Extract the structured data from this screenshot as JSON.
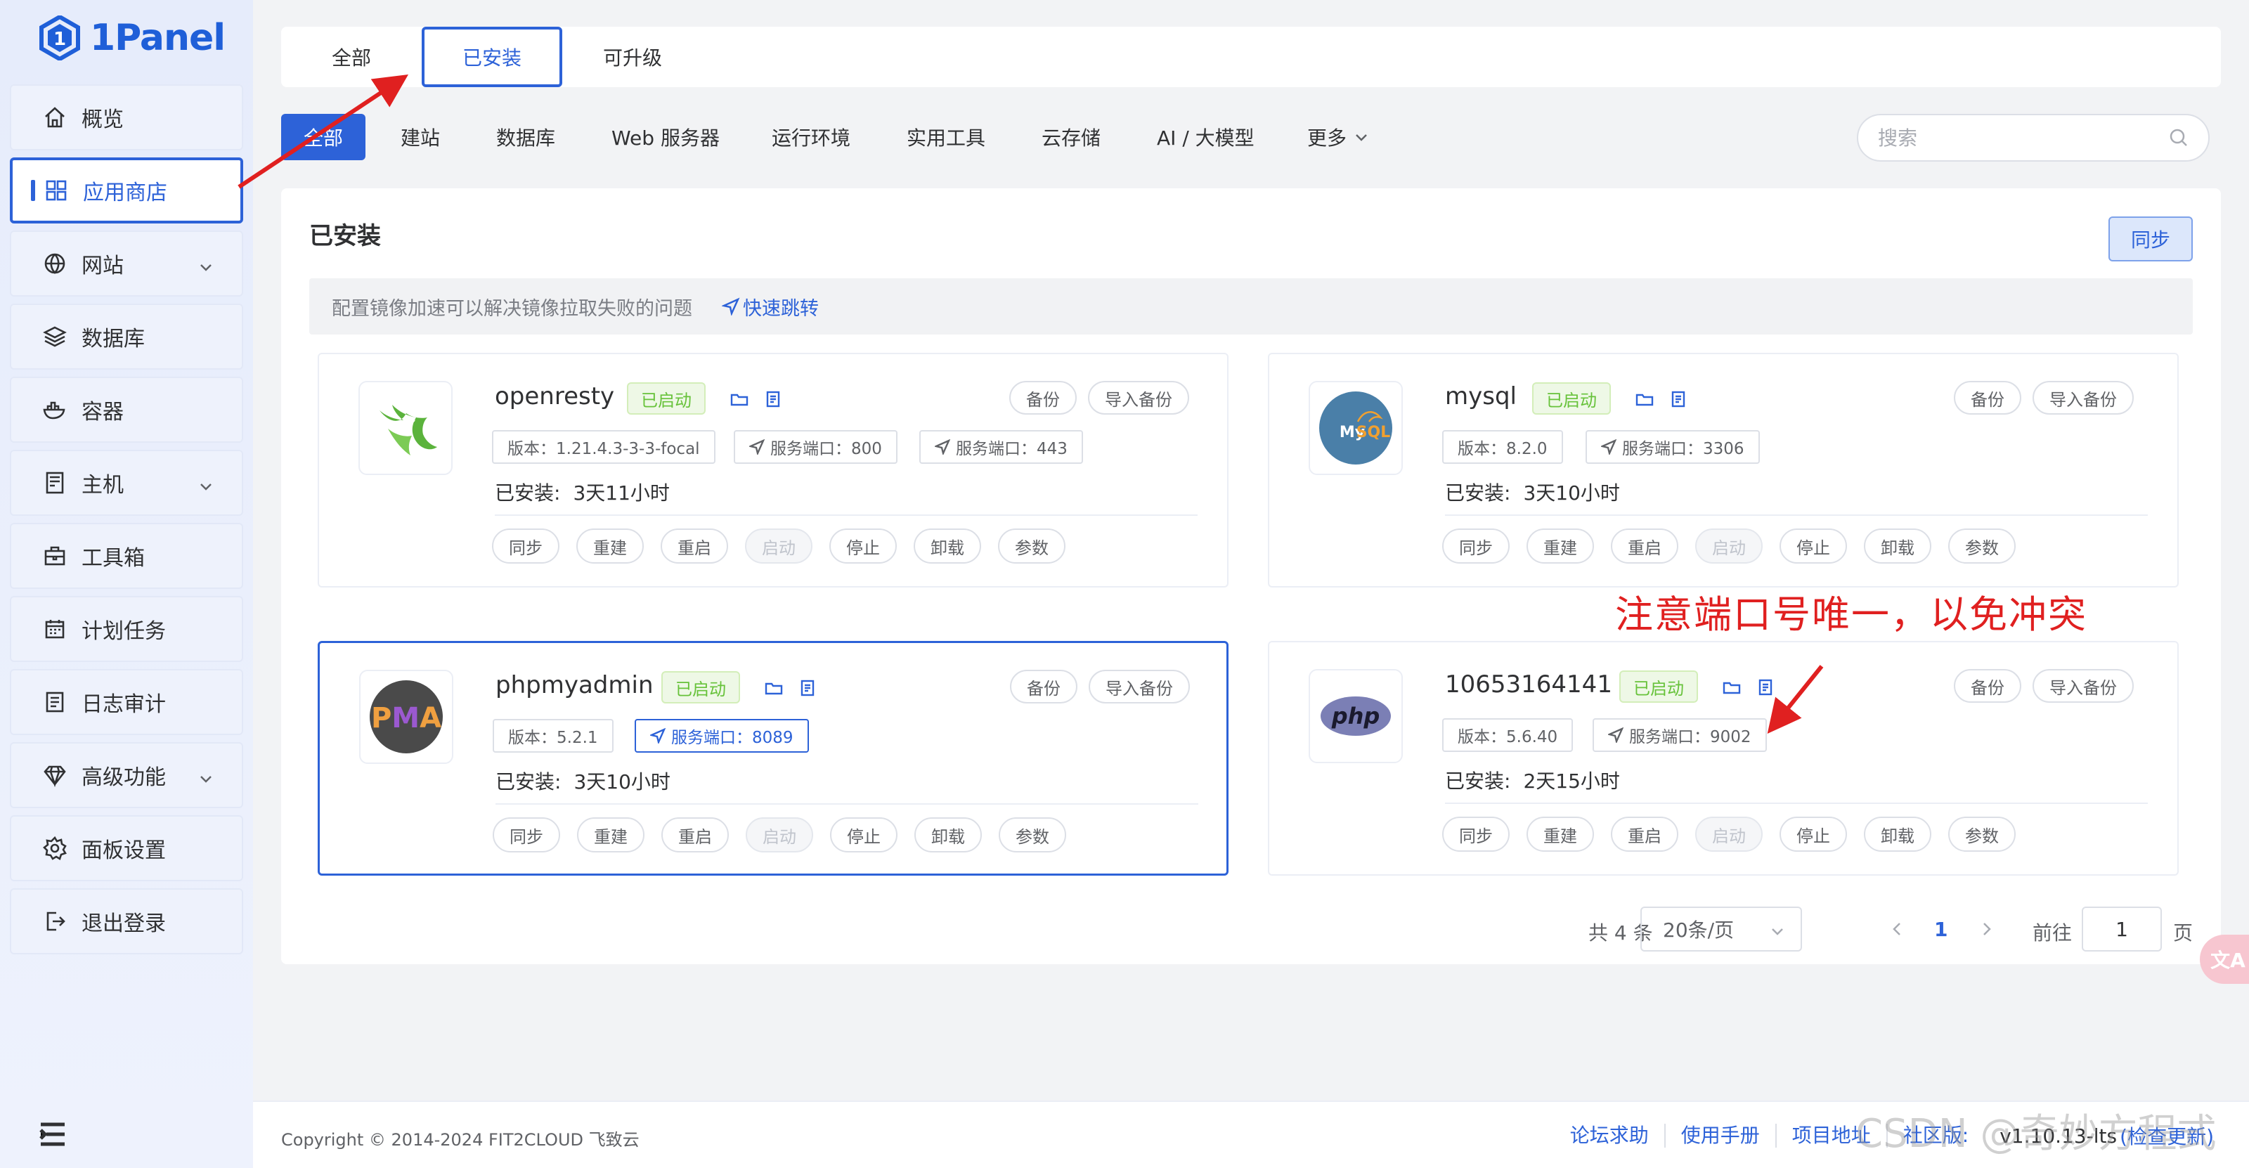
{
  "app": {
    "logo_text": "1Panel"
  },
  "sidebar": {
    "items": [
      {
        "label": "概览",
        "icon": "home-icon"
      },
      {
        "label": "应用商店",
        "icon": "grid-icon"
      },
      {
        "label": "网站",
        "icon": "globe-icon"
      },
      {
        "label": "数据库",
        "icon": "layers-icon"
      },
      {
        "label": "容器",
        "icon": "docker-icon"
      },
      {
        "label": "主机",
        "icon": "server-icon"
      },
      {
        "label": "工具箱",
        "icon": "toolbox-icon"
      },
      {
        "label": "计划任务",
        "icon": "calendar-icon"
      },
      {
        "label": "日志审计",
        "icon": "log-icon"
      },
      {
        "label": "高级功能",
        "icon": "diamond-icon"
      },
      {
        "label": "面板设置",
        "icon": "gear-icon"
      },
      {
        "label": "退出登录",
        "icon": "logout-icon"
      }
    ]
  },
  "top_tabs": [
    "全部",
    "已安装",
    "可升级"
  ],
  "categories": [
    "全部",
    "建站",
    "数据库",
    "Web 服务器",
    "运行环境",
    "实用工具",
    "云存储",
    "AI / 大模型",
    "更多"
  ],
  "search": {
    "placeholder": "搜索"
  },
  "panel": {
    "title": "已安装",
    "sync": "同步",
    "notice": "配置镜像加速可以解决镜像拉取失败的问题",
    "notice_link": "快速跳转"
  },
  "card_labels": {
    "backup": "备份",
    "import_backup": "导入备份",
    "installed": "已安装:",
    "actions": [
      "同步",
      "重建",
      "重启",
      "启动",
      "停止",
      "卸载",
      "参数"
    ]
  },
  "apps": [
    {
      "name": "openresty",
      "status": "已启动",
      "version": "版本：1.21.4.3-3-3-focal",
      "ports": [
        "服务端口：800",
        "服务端口：443"
      ],
      "installed_for": "3天11小时"
    },
    {
      "name": "mysql",
      "status": "已启动",
      "version": "版本：8.2.0",
      "ports": [
        "服务端口：3306"
      ],
      "installed_for": "3天10小时"
    },
    {
      "name": "phpmyadmin",
      "status": "已启动",
      "version": "版本：5.2.1",
      "ports": [
        "服务端口：8089"
      ],
      "installed_for": "3天10小时"
    },
    {
      "name": "10653164141",
      "status": "已启动",
      "version": "版本：5.6.40",
      "ports": [
        "服务端口：9002"
      ],
      "installed_for": "2天15小时"
    }
  ],
  "annotation": "注意端口号唯一，以免冲突",
  "pagination": {
    "total": "共 4 条",
    "page_size": "20条/页",
    "current": "1",
    "goto": "前往",
    "goto_value": "1",
    "page": "页"
  },
  "footer": {
    "copyright": "Copyright © 2014-2024 FIT2CLOUD 飞致云",
    "links": [
      "论坛求助",
      "使用手册",
      "项目地址",
      "社区版:"
    ],
    "version": "v1.10.13-lts",
    "update": "(检查更新)",
    "watermark": "CSDN @奇妙方程式"
  },
  "colors": {
    "accent": "#2d62d8",
    "success": "#67c23a",
    "annotation": "#e02020"
  }
}
